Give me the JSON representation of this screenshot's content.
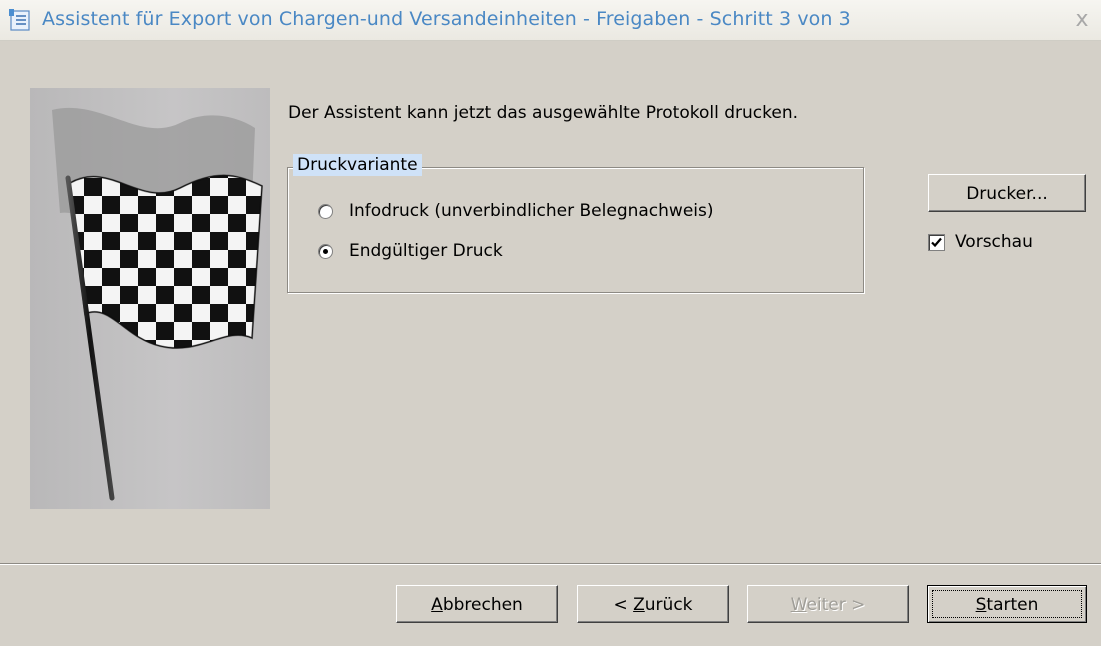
{
  "window": {
    "title": "Assistent für Export von Chargen-und Versandeinheiten - Freigaben - Schritt 3 von 3",
    "close_label": "x",
    "title_icon": "wizard-icon"
  },
  "content": {
    "intro_text": "Der Assistent kann jetzt das ausgewählte Protokoll drucken.",
    "side_image": "checkered-flag-image"
  },
  "print_group": {
    "legend": "Druckvariante",
    "options": [
      {
        "label": "Infodruck (unverbindlicher Belegnachweis)",
        "checked": false
      },
      {
        "label": "Endgültiger Druck",
        "checked": true
      }
    ]
  },
  "printer_button_label": "Drucker...",
  "preview": {
    "label": "Vorschau",
    "checked": true
  },
  "footer": {
    "cancel": {
      "pre": "",
      "key": "A",
      "post": "bbrechen"
    },
    "back": {
      "pre": "< ",
      "key": "Z",
      "post": "urück"
    },
    "next": {
      "pre": "",
      "key": "W",
      "post": "eiter >"
    },
    "start": {
      "pre": "",
      "key": "S",
      "post": "tarten"
    }
  }
}
